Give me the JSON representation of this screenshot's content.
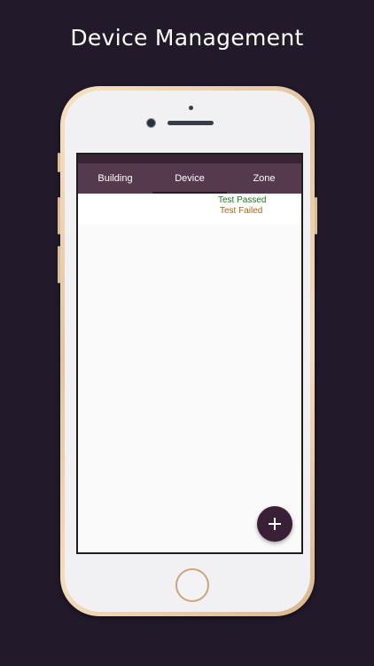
{
  "headline": "Device Management",
  "tabs": [
    {
      "label": "Building",
      "active": false
    },
    {
      "label": "Device",
      "active": true
    },
    {
      "label": "Zone",
      "active": false
    }
  ],
  "list": {
    "status_passed": "Test Passed",
    "status_failed": "Test Failed"
  },
  "fab": {
    "icon": "plus-icon"
  },
  "colors": {
    "background": "#221a2b",
    "tab_bar": "#55394c",
    "status_bar": "#3a2433",
    "fab": "#3a2036",
    "passed": "#1e7a1e",
    "failed": "#b5650e"
  }
}
